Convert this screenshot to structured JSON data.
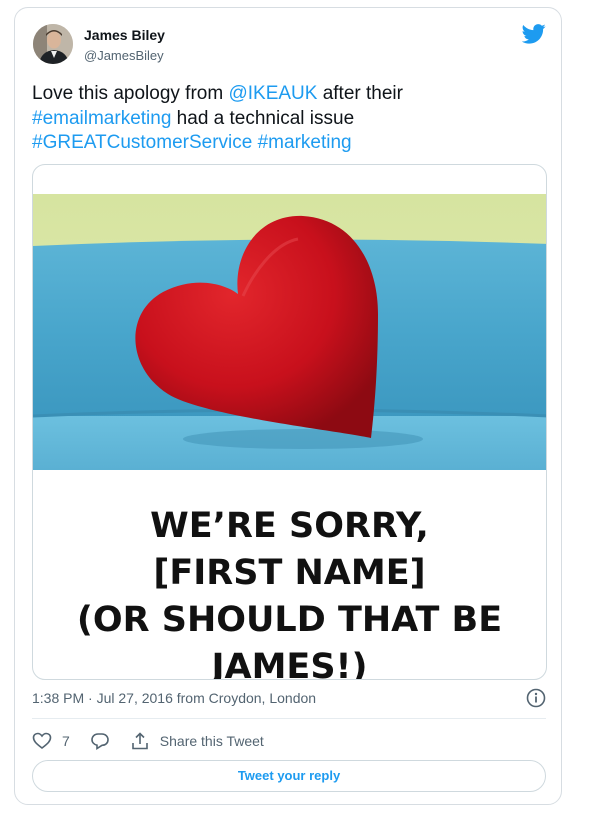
{
  "author": {
    "name": "James Biley",
    "handle": "@JamesBiley"
  },
  "tweet": {
    "text_1": "Love this apology from ",
    "mention": "@IKEAUK",
    "text_2": " after their",
    "hashtag_1": "#emailmarketing",
    "text_3": " had a technical issue",
    "hashtag_2": "#GREATCustomerService",
    "hashtag_3": "#marketing"
  },
  "media": {
    "line_1": "WE’RE SORRY,",
    "line_2": "[FIRST NAME]",
    "line_3": "(OR SHOULD THAT BE",
    "line_4": "JAMES!)"
  },
  "meta": {
    "timestamp": "1:38 PM · Jul 27, 2016 from Croydon, London"
  },
  "actions": {
    "like_count": "7",
    "share_label": "Share this Tweet"
  },
  "reply_button": "Tweet your reply",
  "colors": {
    "link": "#1d9bf0",
    "heart": "#c8101c"
  }
}
